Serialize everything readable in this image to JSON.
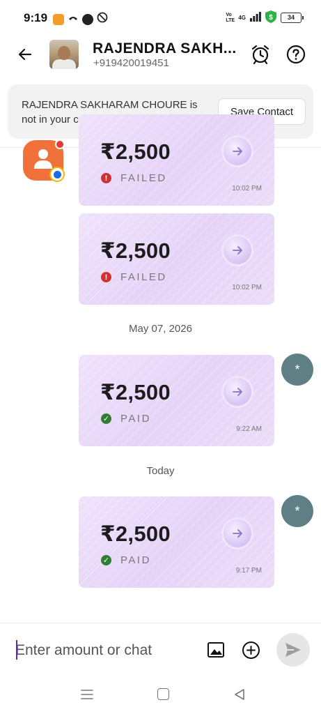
{
  "status_bar": {
    "time": "9:19",
    "network_label": "4G",
    "volte_label": "Vo LTE",
    "battery": "34"
  },
  "header": {
    "contact_name": "RAJENDRA SAKH...",
    "phone": "+919420019451"
  },
  "banner": {
    "message": "RAJENDRA SAKHARAM CHOURE is not in your contacts",
    "save_label": "Save Contact"
  },
  "messages": [
    {
      "amount": "₹2,500",
      "status": "FAILED",
      "time": "10:02 PM"
    },
    {
      "amount": "₹2,500",
      "status": "FAILED",
      "time": "10:02 PM"
    },
    {
      "amount": "₹2,500",
      "status": "PAID",
      "time": "9:22 AM"
    },
    {
      "amount": "₹2,500",
      "status": "PAID",
      "time": "9:17 PM"
    }
  ],
  "date_separators": [
    "May 07, 2026",
    "Today"
  ],
  "me_avatar_label": "*",
  "composer": {
    "placeholder": "Enter amount or chat"
  },
  "colors": {
    "card_bg": "#e8d8f9",
    "failed": "#d32f2f",
    "paid": "#2e7d32",
    "me_avatar": "#5e7f86",
    "sender_avatar": "#f0713a"
  }
}
